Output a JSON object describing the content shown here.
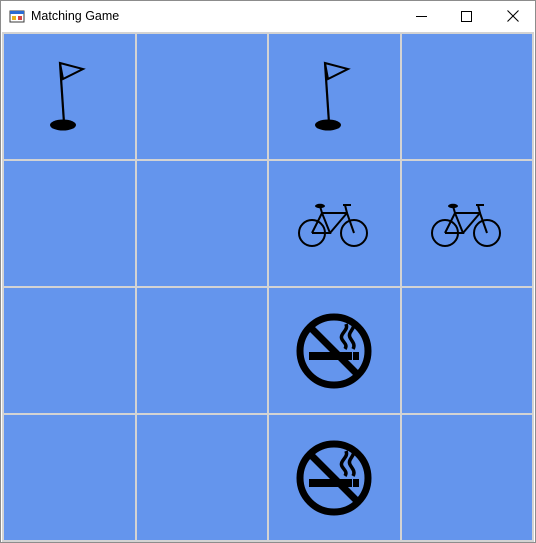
{
  "window": {
    "title": "Matching Game",
    "minimize_glyph": "minimize-icon",
    "maximize_glyph": "maximize-icon",
    "close_glyph": "close-icon"
  },
  "colors": {
    "cell_background": "#6495ed",
    "grid_line": "#d3d3d3",
    "icon": "#000000"
  },
  "board": {
    "rows": 4,
    "columns": 4,
    "cells": [
      [
        "golf-flag-icon",
        "",
        "golf-flag-icon",
        ""
      ],
      [
        "",
        "",
        "bicycle-icon",
        "bicycle-icon"
      ],
      [
        "",
        "",
        "no-smoking-icon",
        ""
      ],
      [
        "",
        "",
        "no-smoking-icon",
        ""
      ]
    ]
  }
}
